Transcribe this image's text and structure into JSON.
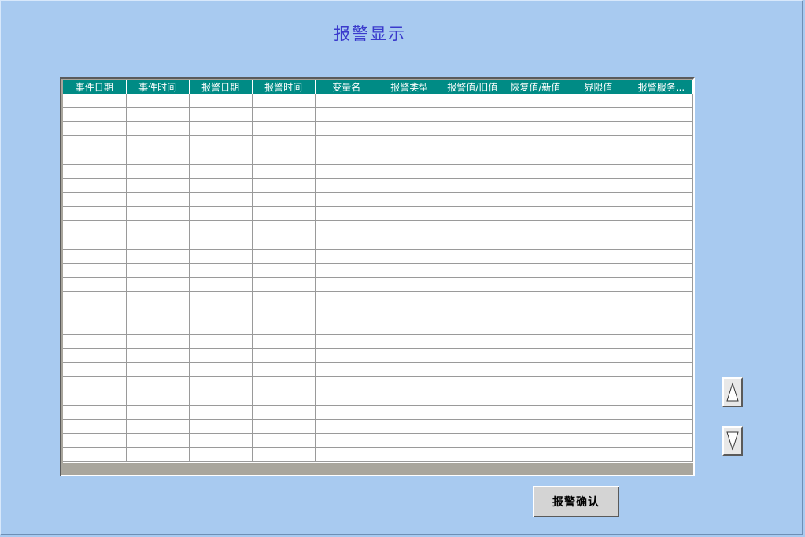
{
  "title": "报警显示",
  "alarm_table": {
    "columns": [
      "事件日期",
      "事件时间",
      "报警日期",
      "报警时间",
      "变量名",
      "报警类型",
      "报警值/旧值",
      "恢复值/新值",
      "界限值",
      "报警服务..."
    ],
    "rows": []
  },
  "scroll_up_icon": "triangle-up-icon",
  "scroll_down_icon": "triangle-down-icon",
  "confirm_button_label": "报警确认",
  "colors": {
    "background": "#a8caf0",
    "header": "#008b85",
    "title": "#3a3acc"
  }
}
